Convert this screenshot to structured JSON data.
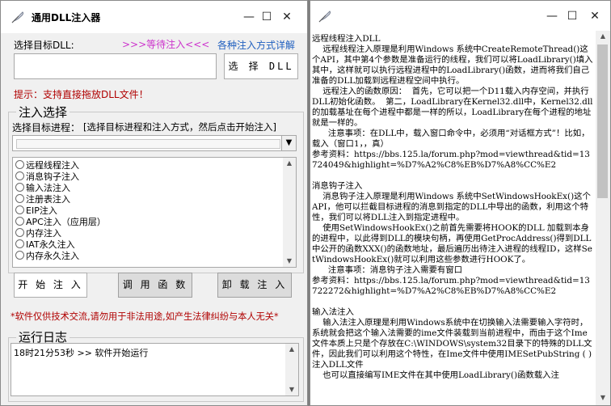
{
  "left_window": {
    "title": "通用DLL注入器",
    "controls": {
      "minimize": "—",
      "maximize": "☐",
      "close": "✕"
    },
    "dll_label": "选择目标DLL:",
    "wait_status": ">>>等待注入<<<",
    "methods_link": "各种注入方式详解",
    "dll_path_value": "",
    "select_dll_button": "选 择 DLL",
    "drag_hint": "提示：支持直接拖放DLL文件！",
    "inject_group": {
      "legend": "注入选择",
      "process_label": "选择目标进程：",
      "process_hint": "[选择目标进程和注入方式，然后点击开始注入]",
      "process_value": "",
      "methods": [
        "远程线程注入",
        "消息钩子注入",
        "输入法注入",
        "注册表注入",
        "EIP注入",
        "APC注入（应用层）",
        "内存注入",
        "IAT永久注入",
        "内存永久注入"
      ]
    },
    "buttons": {
      "start": "开 始 注 入",
      "call": "调 用 函 数",
      "unload": "卸 载 注 入"
    },
    "disclaimer": "*软件仅供技术交流,请勿用于非法用途,如产生法律纠纷与本人无关*",
    "log": {
      "legend": "运行日志",
      "lines": [
        "18时21分53秒 >> 软件开始运行"
      ]
    },
    "colors": {
      "status": "#cc33cc",
      "link": "#1f5fbf",
      "hint": "#b00000"
    }
  },
  "right_window": {
    "controls": {
      "minimize": "—",
      "maximize": "☐",
      "close": "✕"
    },
    "doc_text": "远程线程注入DLL\n    远程线程注入原理是利用Windows 系统中CreateRemoteThread()这个API，其中第4个参数是准备运行的线程，我们可以将LoadLibrary()填入其中，这样就可以执行远程进程中的LoadLibrary()函数，进而将我们自己准备的DLL加载到远程进程空间中执行。\n    远程注入的函数原因：  首先，它可以把一个D11载入内存空间，并执行DLL初始化函数。  第二，LoadLibrary在Kernel32.dll中，Kernel32.dll的加载基址在每个进程中都是一样的所以，LoadLibrary在每个进程的地址就是一样的。\n      注意事项：在DLL中，载入窗口命令中，必须用“对话框方式”！比如，载入（窗口1，，真）\n参考资料：https://bbs.125.la/forum.php?mod=viewthread&tid=13724049&highlight=%D7%A2%C8%EB%D7%A8%CC%E2\n\n消息钩子注入\n    消息钩子注入原理是利用Windows 系统中SetWindowsHookEx()这个API，他可以拦截目标进程的消息到指定的DLL中导出的函数，利用这个特性，我们可以将DLL注入到指定进程中。\n    使用SetWindowsHookEx()之前首先需要将HOOK的DLL 加载到本身的进程中，以此得到DLL的模块句柄，再使用GetProcAddress()得到DLL中公开的函数XXX()的函数地址，最后遍历出待注入进程的线程ID，这样SetWindowsHookEx()就可以利用这些参数进行HOOK了。\n      注意事项：消息钩子注入需要有窗口\n参考资料：https://bbs.125.la/forum.php?mod=viewthread&tid=13722272&highlight=%D7%A2%C8%EB%D7%A8%CC%E2\n\n输入法注入\n    输入法注入原理是利用Windows系统中在切换输入法需要输入字符时，系统就会把这个输入法需要的ime文件装载到当前进程中，而由于这个Ime文件本质上只是个存放在C:\\WINDOWS\\system32目录下的特殊的DLL文件，因此我们可以利用这个特性，在Ime文件中使用IMESetPubString ( ) 注入DLL文件\n    也可以直接编写IME文件在其中使用LoadLibrary()函数载入注"
  }
}
